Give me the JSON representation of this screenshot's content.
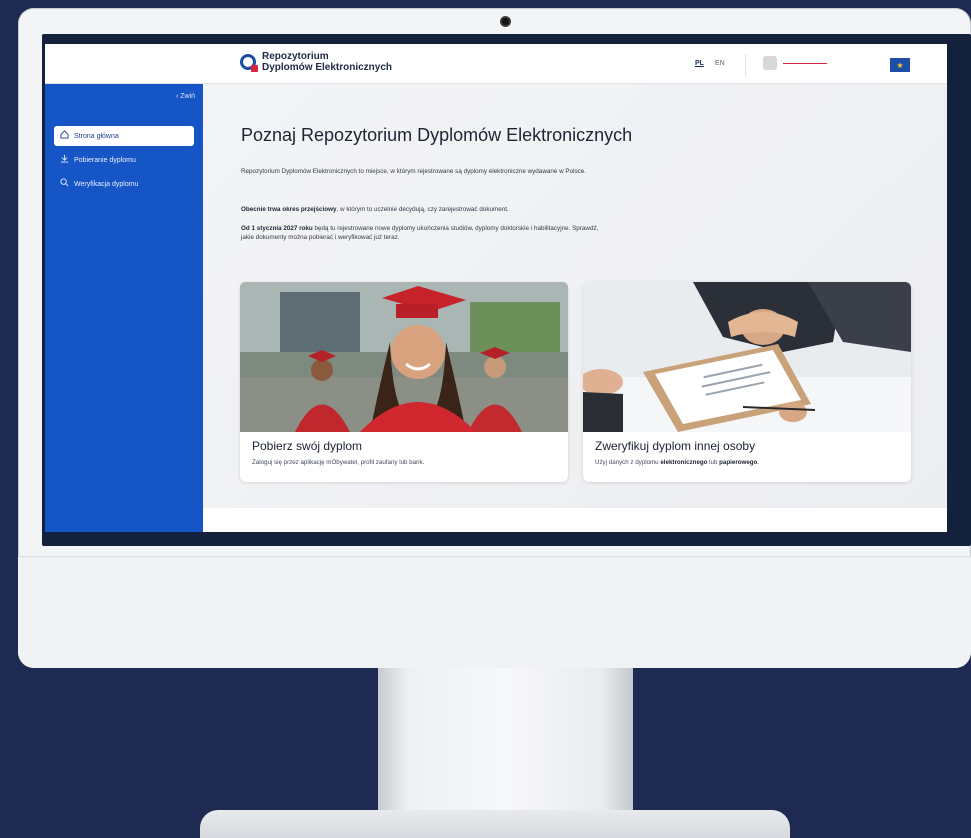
{
  "header": {
    "logo_line1": "Repozytorium",
    "logo_line2": "Dyplomów Elektronicznych",
    "lang_pl": "PL",
    "lang_en": "EN"
  },
  "sidebar": {
    "collapse_label": "‹ Zwiń",
    "items": [
      {
        "label": "Strona główna",
        "icon": "home-icon"
      },
      {
        "label": "Pobieranie dyplomu",
        "icon": "download-icon"
      },
      {
        "label": "Weryfikacja dyplomu",
        "icon": "search-icon"
      }
    ]
  },
  "main": {
    "title": "Poznaj Repozytorium Dyplomów Elektronicznych",
    "intro": "Repozytorium Dyplomów Elektronicznych to miejsce, w którym rejestrowane są dyplomy elektroniczne wydawane w Polsce.",
    "transition_bold": "Obecnie trwa okres przejściowy",
    "transition_rest": ", w którym to uczelnie decydują, czy zarejestrować dokument.",
    "future_bold": "Od 1 stycznia 2027 roku",
    "future_rest": " będą tu rejestrowane nowe dyplomy ukończenia studiów, dyplomy doktorskie i habilitacyjne. Sprawdź, jakie dokumenty można pobierać i weryfikować już teraz."
  },
  "cards": [
    {
      "title": "Pobierz swój dyplom",
      "desc": "Zaloguj się przez aplikację mObywatel, profil zaufany lub bank."
    },
    {
      "title": "Zweryfikuj dyplom innej osoby",
      "desc_pre": "Użyj danych z dyplomu ",
      "desc_bold1": "elektronicznego",
      "desc_mid": " lub ",
      "desc_bold2": "papierowego",
      "desc_post": "."
    }
  ],
  "colors": {
    "sidebar": "#1655c5",
    "page_bg": "#1f2a52",
    "accent_red": "#d7263d"
  }
}
